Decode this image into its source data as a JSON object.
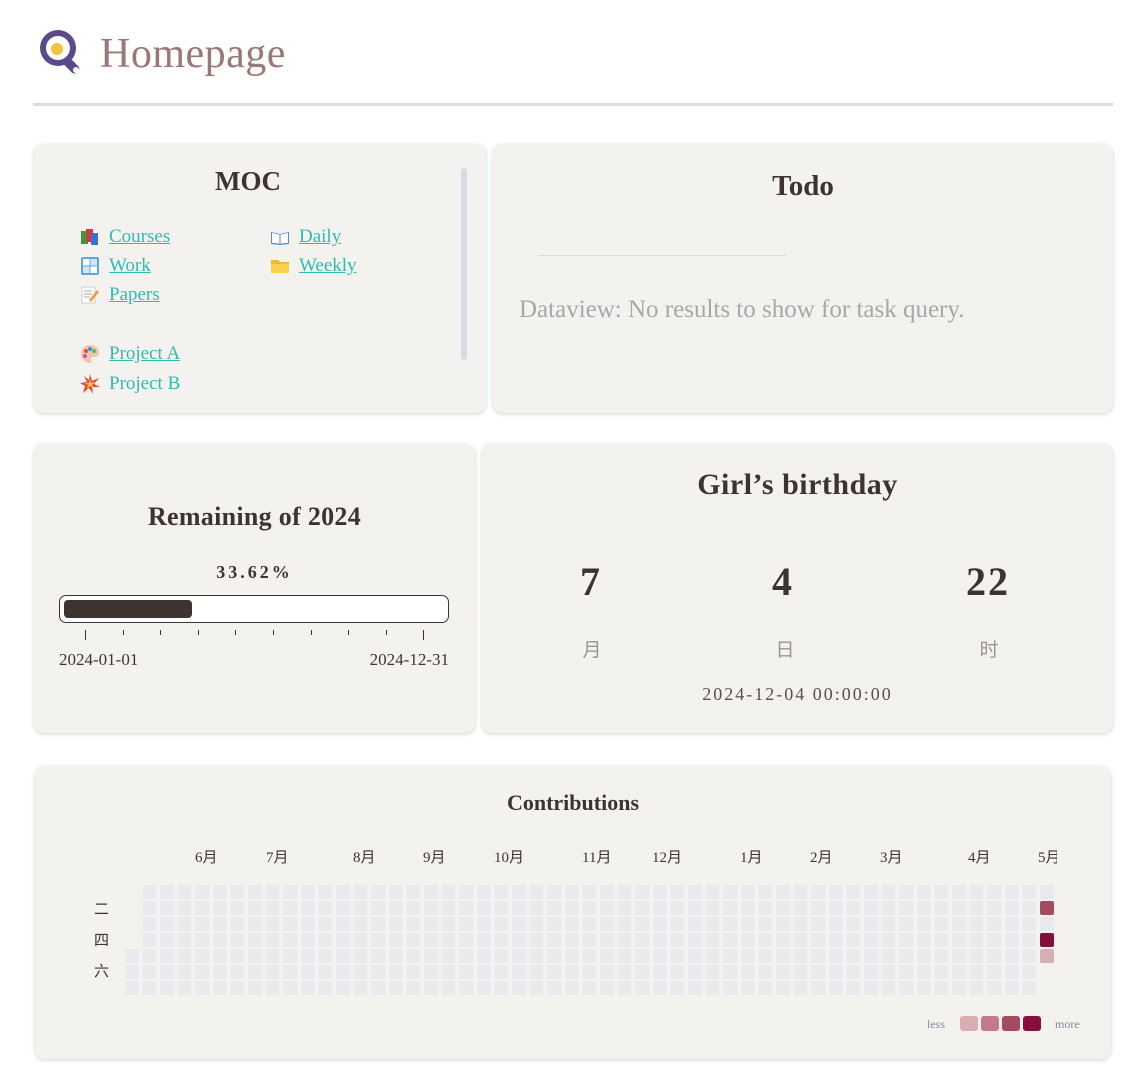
{
  "page": {
    "title": "Homepage"
  },
  "moc": {
    "title": "MOC",
    "links": [
      {
        "label": "Courses",
        "icon": "books-icon"
      },
      {
        "label": "Daily",
        "icon": "open-book-icon"
      },
      {
        "label": "Work",
        "icon": "windows-icon"
      },
      {
        "label": "Weekly",
        "icon": "folder-icon"
      },
      {
        "label": "Papers",
        "icon": "memo-icon"
      },
      {
        "label": "Project A",
        "icon": "palette-icon"
      },
      {
        "label": "Project B",
        "icon": "collision-icon"
      }
    ]
  },
  "todo": {
    "title": "Todo",
    "message": "Dataview: No results to show for task query."
  },
  "remaining": {
    "title": "Remaining of 2024",
    "percent_label": "33.62%",
    "progress_fraction": 0.3362,
    "start_date": "2024-01-01",
    "end_date": "2024-12-31"
  },
  "birthday": {
    "title": "Girl’s birthday",
    "counters": [
      {
        "value": "7",
        "unit": "月"
      },
      {
        "value": "4",
        "unit": "日"
      },
      {
        "value": "22",
        "unit": "时"
      }
    ],
    "target": "2024-12-04 00:00:00"
  },
  "contributions": {
    "title": "Contributions",
    "months": [
      "6月",
      "7月",
      "8月",
      "9月",
      "10月",
      "11月",
      "12月",
      "1月",
      "2月",
      "3月",
      "4月",
      "5月"
    ],
    "weekdays": [
      "二",
      "四",
      "六"
    ],
    "legend_less": "less",
    "legend_more": "more",
    "legend_colors": [
      "#d9aeb3",
      "#c57a87",
      "#a64b5f",
      "#860e3a"
    ],
    "empty_color": "#e9e9ee",
    "active_days": [
      {
        "week": 52,
        "day": 1,
        "level": 3
      },
      {
        "week": 52,
        "day": 3,
        "level": 4
      },
      {
        "week": 52,
        "day": 4,
        "level": 1
      }
    ]
  },
  "colors": {
    "accent_link": "#2dbcb0",
    "title": "#9a7878",
    "card_bg": "#f3f2ef",
    "bar": "#3d3430"
  }
}
